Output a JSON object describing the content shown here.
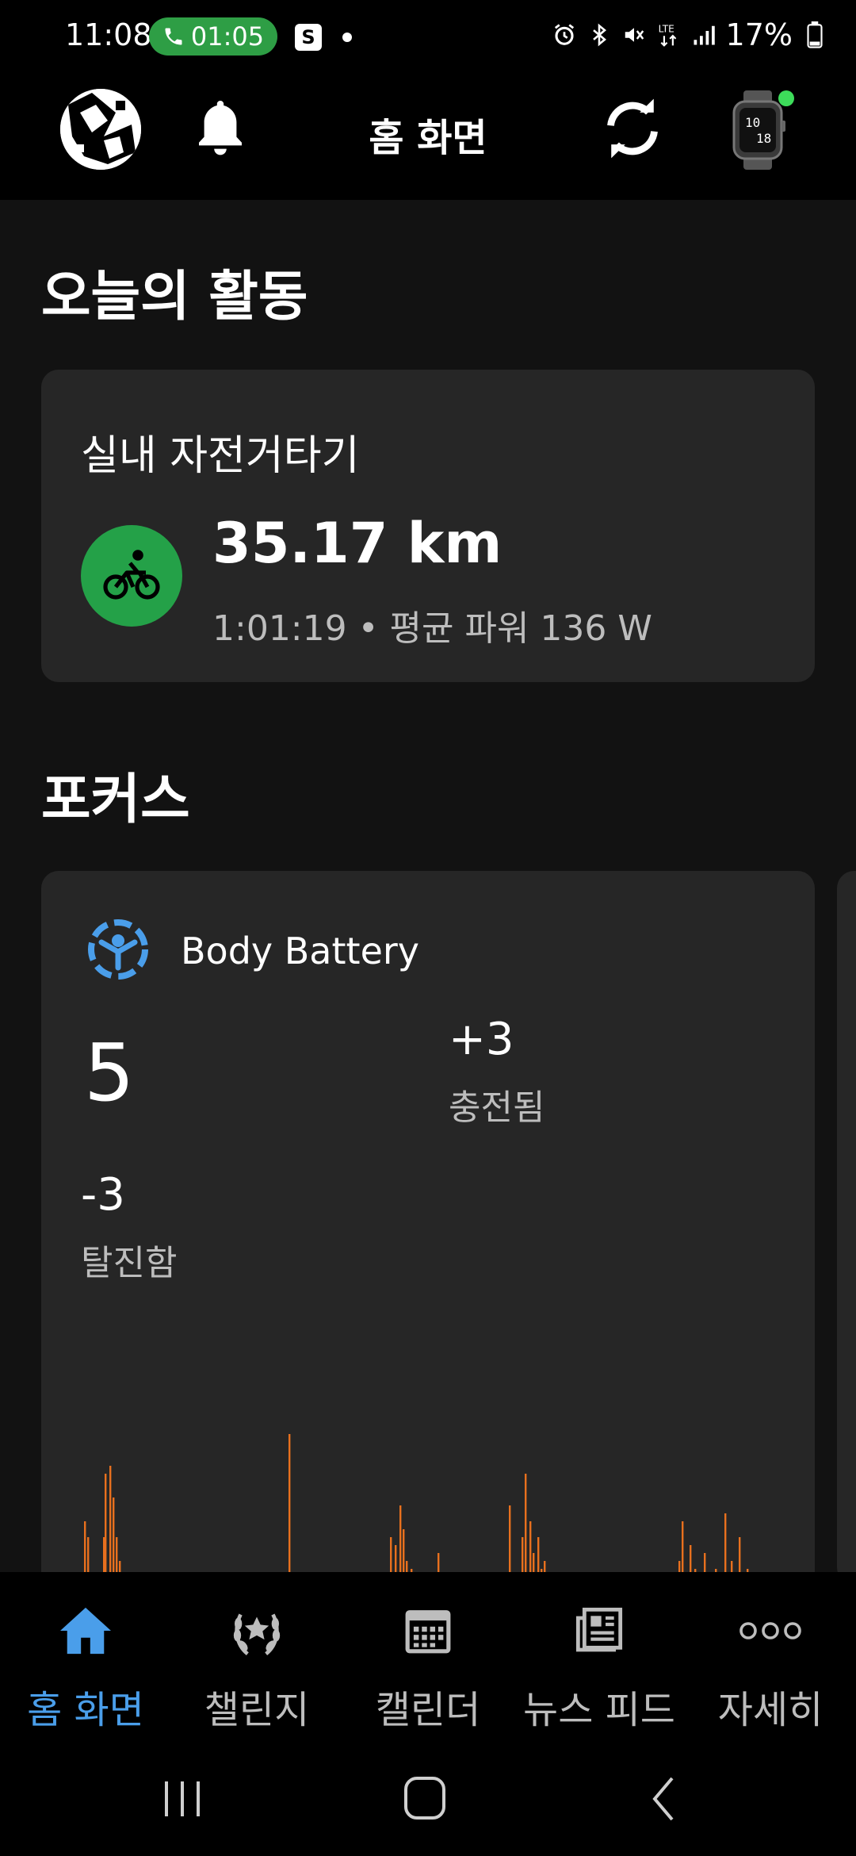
{
  "status_bar": {
    "time": "11:08",
    "call_timer": "01:05",
    "app_badge": "S",
    "battery_percent": "17%"
  },
  "header": {
    "title": "홈 화면"
  },
  "today": {
    "section_title": "오늘의 활동",
    "activity": {
      "name": "실내 자전거타기",
      "distance": "35.17 km",
      "meta": "1:01:19 • 평균 파워 136 W",
      "icon": "bike-icon"
    }
  },
  "focus": {
    "section_title": "포커스",
    "body_battery": {
      "label": "Body Battery",
      "value": "5",
      "charged_value": "+3",
      "charged_label": "충전됨",
      "drained_value": "-3",
      "drained_label": "탈진함",
      "chart_color": "#e8701e"
    }
  },
  "bottom_nav": {
    "items": [
      {
        "label": "홈 화면",
        "icon": "home-icon",
        "active": true
      },
      {
        "label": "챌린지",
        "icon": "laurel-icon",
        "active": false
      },
      {
        "label": "캘린더",
        "icon": "calendar-icon",
        "active": false
      },
      {
        "label": "뉴스 피드",
        "icon": "newsfeed-icon",
        "active": false
      },
      {
        "label": "자세히",
        "icon": "more-icon",
        "active": false
      }
    ]
  },
  "colors": {
    "accent": "#4a9eea",
    "activity_green": "#24a148",
    "call_green": "#2e9e45",
    "watch_status": "#3ddc5a"
  }
}
